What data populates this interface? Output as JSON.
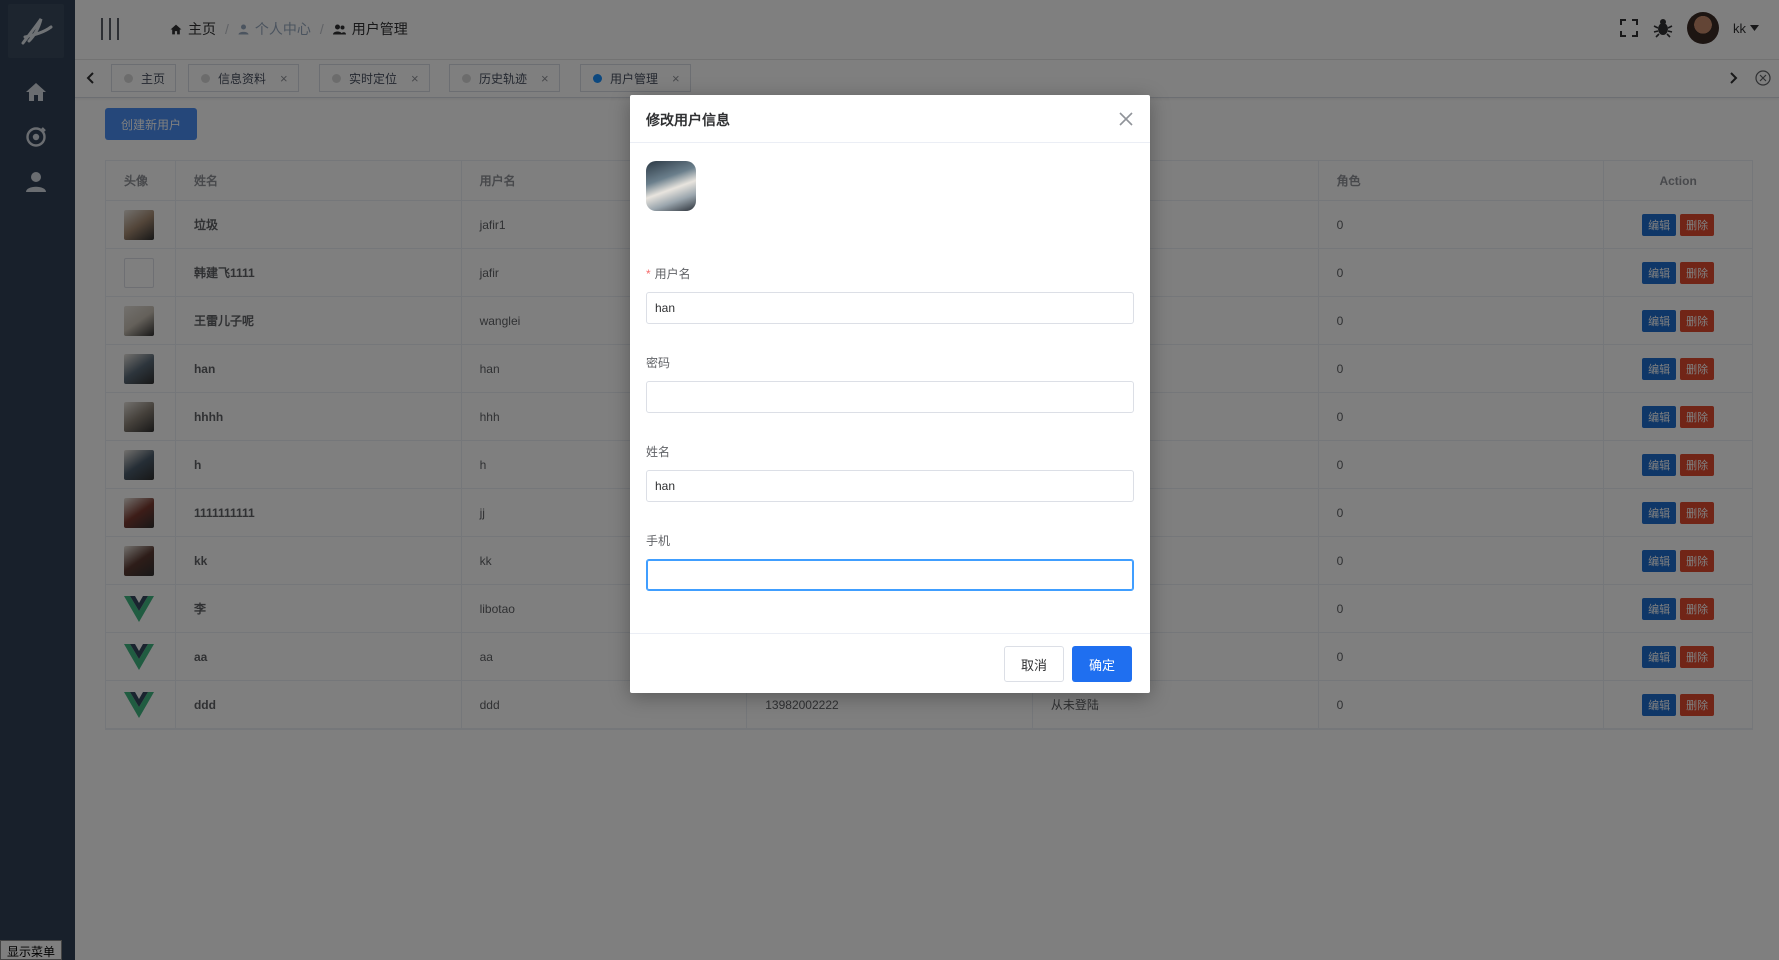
{
  "sidebar": {
    "show_menu_label": "显示菜单",
    "items": [
      {
        "icon": "home-icon"
      },
      {
        "icon": "location-target-icon"
      },
      {
        "icon": "user-icon"
      }
    ]
  },
  "header": {
    "breadcrumb": [
      "主页",
      "个人中心",
      "用户管理"
    ],
    "user_name": "kk"
  },
  "tags": [
    {
      "label": "主页",
      "closable": false,
      "active": false
    },
    {
      "label": "信息资料",
      "closable": true,
      "active": false
    },
    {
      "label": "实时定位",
      "closable": true,
      "active": false
    },
    {
      "label": "历史轨迹",
      "closable": true,
      "active": false
    },
    {
      "label": "用户管理",
      "closable": true,
      "active": true
    }
  ],
  "main": {
    "create_label": "创建新用户",
    "columns": [
      "头像",
      "姓名",
      "用户名",
      "",
      "",
      "角色",
      "Action"
    ],
    "edit_label": "编辑",
    "delete_label": "删除",
    "rows": [
      {
        "avatar": "photo",
        "avatar_color": "#a58a72",
        "name": "垃圾",
        "username": "jafir1",
        "phone": "",
        "status": "",
        "role": "0"
      },
      {
        "avatar": "empty",
        "avatar_color": "#ffffff",
        "name": "韩建飞1111",
        "username": "jafir",
        "phone": "",
        "status": "",
        "role": "0"
      },
      {
        "avatar": "photo",
        "avatar_color": "#c9c1b5",
        "name": "王雷儿子呢",
        "username": "wanglei",
        "phone": "",
        "status": "",
        "role": "0"
      },
      {
        "avatar": "photo",
        "avatar_color": "#5a6a78",
        "name": "han",
        "username": "han",
        "phone": "",
        "status": "",
        "role": "0"
      },
      {
        "avatar": "photo",
        "avatar_color": "#8a8176",
        "name": "hhhh",
        "username": "hhh",
        "phone": "",
        "status": "",
        "role": "0"
      },
      {
        "avatar": "photo",
        "avatar_color": "#4b5c6c",
        "name": "h",
        "username": "h",
        "phone": "",
        "status": "",
        "role": "0"
      },
      {
        "avatar": "photo",
        "avatar_color": "#7a3a30",
        "name": "1111111111",
        "username": "jj",
        "phone": "",
        "status": "",
        "role": "0"
      },
      {
        "avatar": "photo",
        "avatar_color": "#5b3a32",
        "name": "kk",
        "username": "kk",
        "phone": "",
        "status": "",
        "role": "0"
      },
      {
        "avatar": "vue",
        "avatar_color": "#41b883",
        "name": "李",
        "username": "libotao",
        "phone": "",
        "status": "",
        "role": "0"
      },
      {
        "avatar": "vue",
        "avatar_color": "#41b883",
        "name": "aa",
        "username": "aa",
        "phone": "",
        "status": "",
        "role": "0"
      },
      {
        "avatar": "vue",
        "avatar_color": "#41b883",
        "name": "ddd",
        "username": "ddd",
        "phone": "13982002222",
        "status": "从未登陆",
        "role": "0"
      }
    ]
  },
  "dialog": {
    "title": "修改用户信息",
    "username_label": "用户名",
    "username_value": "han",
    "password_label": "密码",
    "password_value": "",
    "realname_label": "姓名",
    "realname_value": "han",
    "phone_label": "手机",
    "phone_value": "",
    "cancel_label": "取消",
    "confirm_label": "确定"
  },
  "colors": {
    "sidebar_bg": "#304156",
    "primary": "#1f6ff0",
    "danger": "#e24a2f",
    "overlay": "rgba(0,0,0,0.5)"
  }
}
